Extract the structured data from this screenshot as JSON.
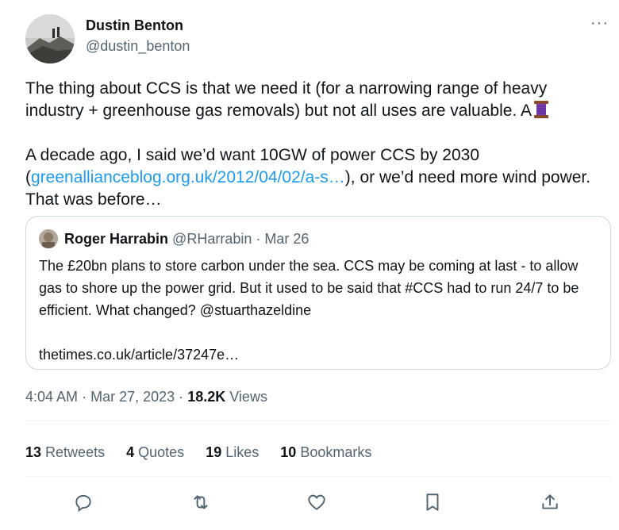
{
  "author": {
    "name": "Dustin Benton",
    "handle": "@dustin_benton"
  },
  "more_label": "···",
  "body": {
    "para1": "The thing about CCS is that we need it (for a narrowing range of heavy industry + greenhouse gas removals) but not all uses are valuable. A",
    "para2_before": "A decade ago, I said we’d want 10GW of power CCS by 2030 (",
    "para2_link": "greenallianceblog.org.uk/2012/04/02/a-s…",
    "para2_after": "), or we’d need more wind power. That was before…"
  },
  "quote": {
    "name": "Roger Harrabin",
    "handle": "@RHarrabin",
    "separator": "·",
    "date": "Mar 26",
    "text": "The £20bn plans to store carbon under the sea. CCS may be coming at last - to allow gas to shore up the power grid. But it used to be said that #CCS had to run 24/7 to be efficient. What changed? @stuarthazeldine",
    "link": "thetimes.co.uk/article/37247e…"
  },
  "meta": {
    "time": "4:04 AM",
    "sep1": "·",
    "date": "Mar 27, 2023",
    "sep2": "·",
    "views_count": "18.2K",
    "views_label": "Views"
  },
  "stats": {
    "retweets_count": "13",
    "retweets_label": "Retweets",
    "quotes_count": "4",
    "quotes_label": "Quotes",
    "likes_count": "19",
    "likes_label": "Likes",
    "bookmarks_count": "10",
    "bookmarks_label": "Bookmarks"
  },
  "icons": {
    "reply": "reply-icon",
    "retweet": "retweet-icon",
    "like": "heart-icon",
    "bookmark": "bookmark-icon",
    "share": "share-icon",
    "emoji": "thread-spool-icon"
  },
  "colors": {
    "link": "#1d9bf0",
    "secondary_text": "#536471",
    "border": "#cfd9de"
  }
}
